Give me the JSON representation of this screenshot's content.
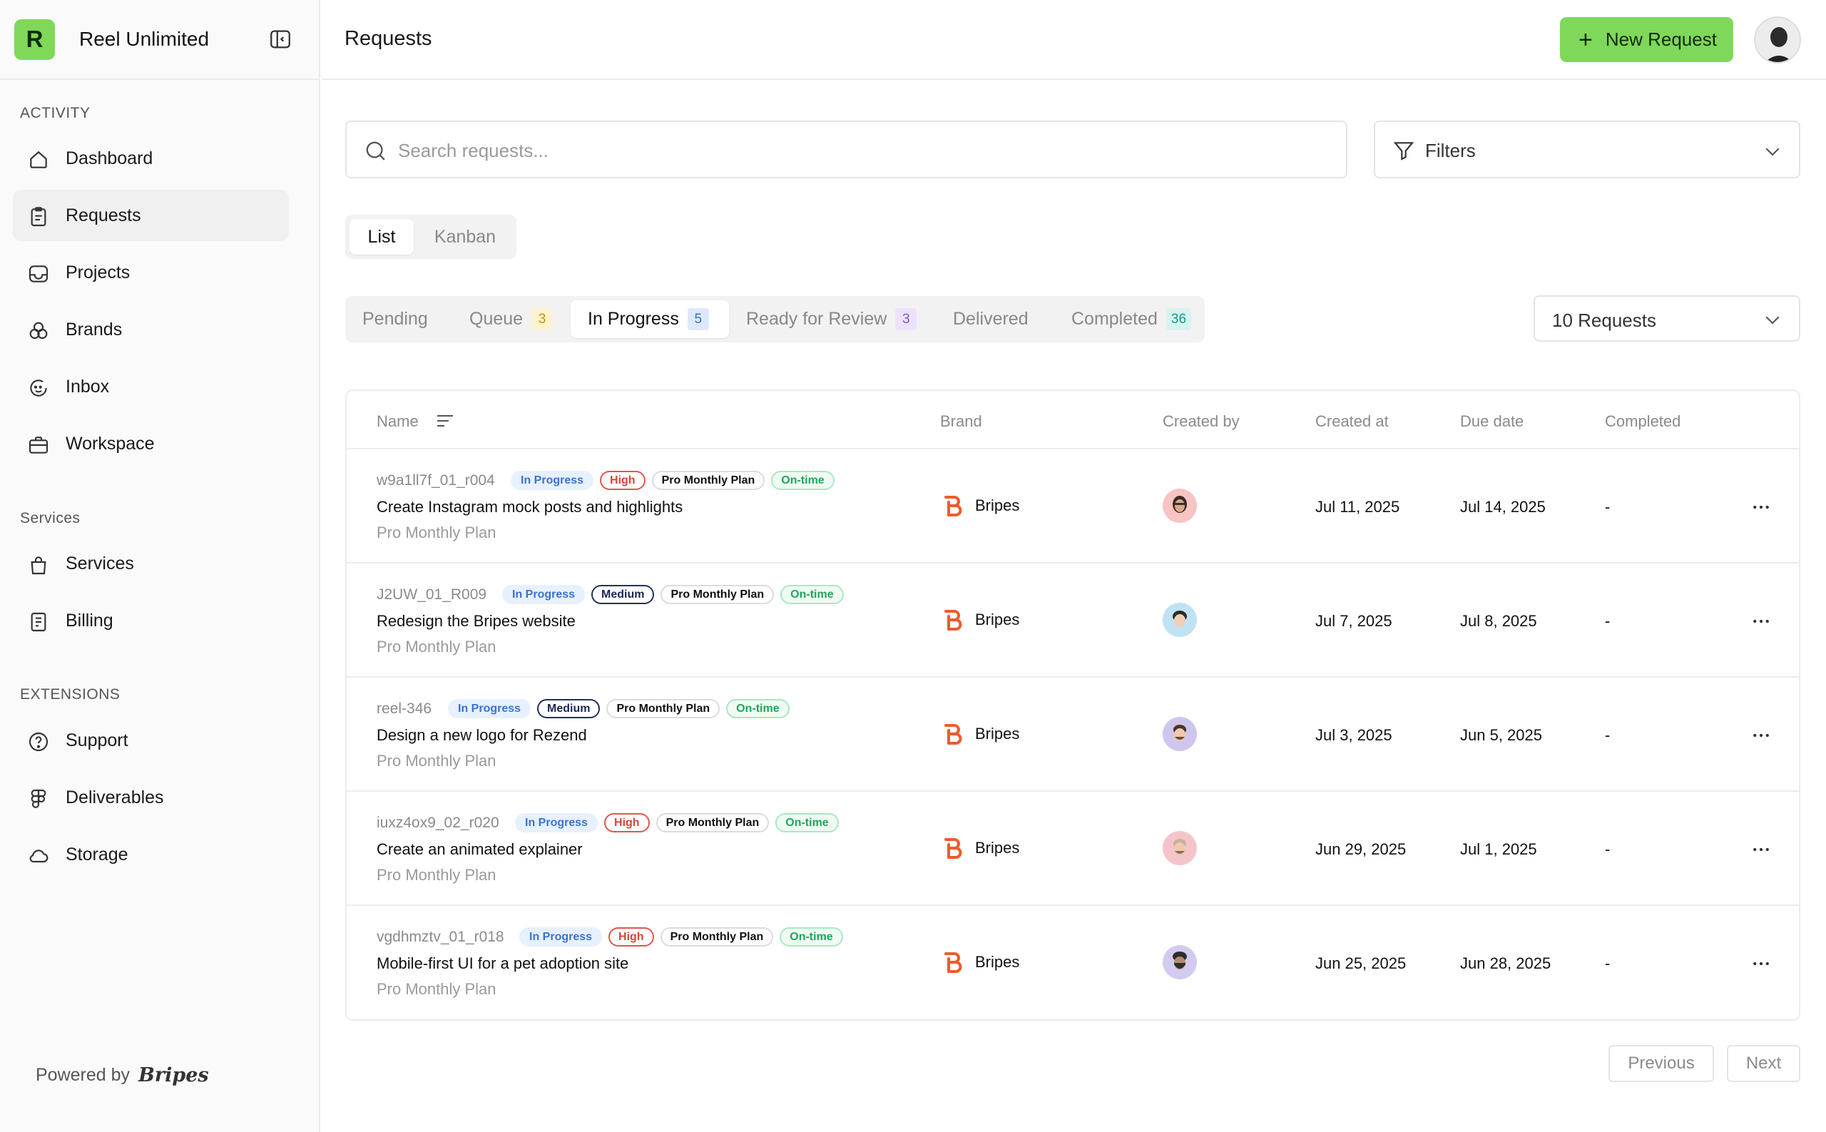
{
  "app": {
    "name": "Reel Unlimited",
    "logo_letter": "R",
    "accent": "#7fd85a"
  },
  "sidebar": {
    "sections": [
      {
        "title": "ACTIVITY",
        "items": [
          {
            "label": "Dashboard",
            "icon": "home-icon"
          },
          {
            "label": "Requests",
            "icon": "clipboard-icon",
            "active": true
          },
          {
            "label": "Projects",
            "icon": "inbox-tray-icon"
          },
          {
            "label": "Brands",
            "icon": "brands-icon"
          },
          {
            "label": "Inbox",
            "icon": "chat-icon"
          },
          {
            "label": "Workspace",
            "icon": "briefcase-icon"
          }
        ]
      },
      {
        "title": "Services",
        "items": [
          {
            "label": "Services",
            "icon": "shopping-bag-icon"
          },
          {
            "label": "Billing",
            "icon": "receipt-icon"
          }
        ]
      },
      {
        "title": "EXTENSIONS",
        "items": [
          {
            "label": "Support",
            "icon": "help-circle-icon"
          },
          {
            "label": "Deliverables",
            "icon": "figma-icon"
          },
          {
            "label": "Storage",
            "icon": "cloud-icon"
          }
        ]
      }
    ],
    "powered_by": "Powered by",
    "powered_brand": "Bripes"
  },
  "header": {
    "title": "Requests",
    "new_request_label": "New Request"
  },
  "search": {
    "placeholder": "Search requests..."
  },
  "filters": {
    "label": "Filters"
  },
  "view_toggle": {
    "list": "List",
    "kanban": "Kanban",
    "selected": "List"
  },
  "status_tabs": [
    {
      "label": "Pending",
      "count": ""
    },
    {
      "label": "Queue",
      "count": "3"
    },
    {
      "label": "In Progress",
      "count": "5",
      "active": true
    },
    {
      "label": "Ready for Review",
      "count": "3"
    },
    {
      "label": "Delivered",
      "count": ""
    },
    {
      "label": "Completed",
      "count": "36"
    }
  ],
  "per_page": {
    "label": "10 Requests"
  },
  "table": {
    "columns": [
      "Name",
      "Brand",
      "Created by",
      "Created at",
      "Due date",
      "Completed"
    ],
    "rows": [
      {
        "id": "w9a1ll7f_01_r004",
        "status": "In Progress",
        "priority": "High",
        "plan_chip": "Pro Monthly Plan",
        "timing": "On-time",
        "title": "Create Instagram mock posts and highlights",
        "plan": "Pro Monthly Plan",
        "brand": "Bripes",
        "avatar_color": "#f7c3c3",
        "created_at": "Jul 11, 2025",
        "due_date": "Jul 14, 2025",
        "completed": "-"
      },
      {
        "id": "J2UW_01_R009",
        "status": "In Progress",
        "priority": "Medium",
        "plan_chip": "Pro Monthly Plan",
        "timing": "On-time",
        "title": "Redesign the Bripes website",
        "plan": "Pro Monthly Plan",
        "brand": "Bripes",
        "avatar_color": "#bfe3f2",
        "created_at": "Jul 7, 2025",
        "due_date": "Jul 8, 2025",
        "completed": "-"
      },
      {
        "id": "reel-346",
        "status": "In Progress",
        "priority": "Medium",
        "plan_chip": "Pro Monthly Plan",
        "timing": "On-time",
        "title": "Design a new logo for Rezend",
        "plan": "Pro Monthly Plan",
        "brand": "Bripes",
        "avatar_color": "#cfc6ee",
        "created_at": "Jul 3, 2025",
        "due_date": "Jun 5, 2025",
        "completed": "-"
      },
      {
        "id": "iuxz4ox9_02_r020",
        "status": "In Progress",
        "priority": "High",
        "plan_chip": "Pro Monthly Plan",
        "timing": "On-time",
        "title": "Create an animated explainer",
        "plan": "Pro Monthly Plan",
        "brand": "Bripes",
        "avatar_color": "#f5c4cb",
        "created_at": "Jun 29, 2025",
        "due_date": "Jul 1, 2025",
        "completed": "-"
      },
      {
        "id": "vgdhmztv_01_r018",
        "status": "In Progress",
        "priority": "High",
        "plan_chip": "Pro Monthly Plan",
        "timing": "On-time",
        "title": "Mobile-first UI for a pet adoption site",
        "plan": "Pro Monthly Plan",
        "brand": "Bripes",
        "avatar_color": "#d3cbef",
        "created_at": "Jun 25, 2025",
        "due_date": "Jun 28, 2025",
        "completed": "-"
      }
    ]
  },
  "pagination": {
    "previous": "Previous",
    "next": "Next"
  }
}
